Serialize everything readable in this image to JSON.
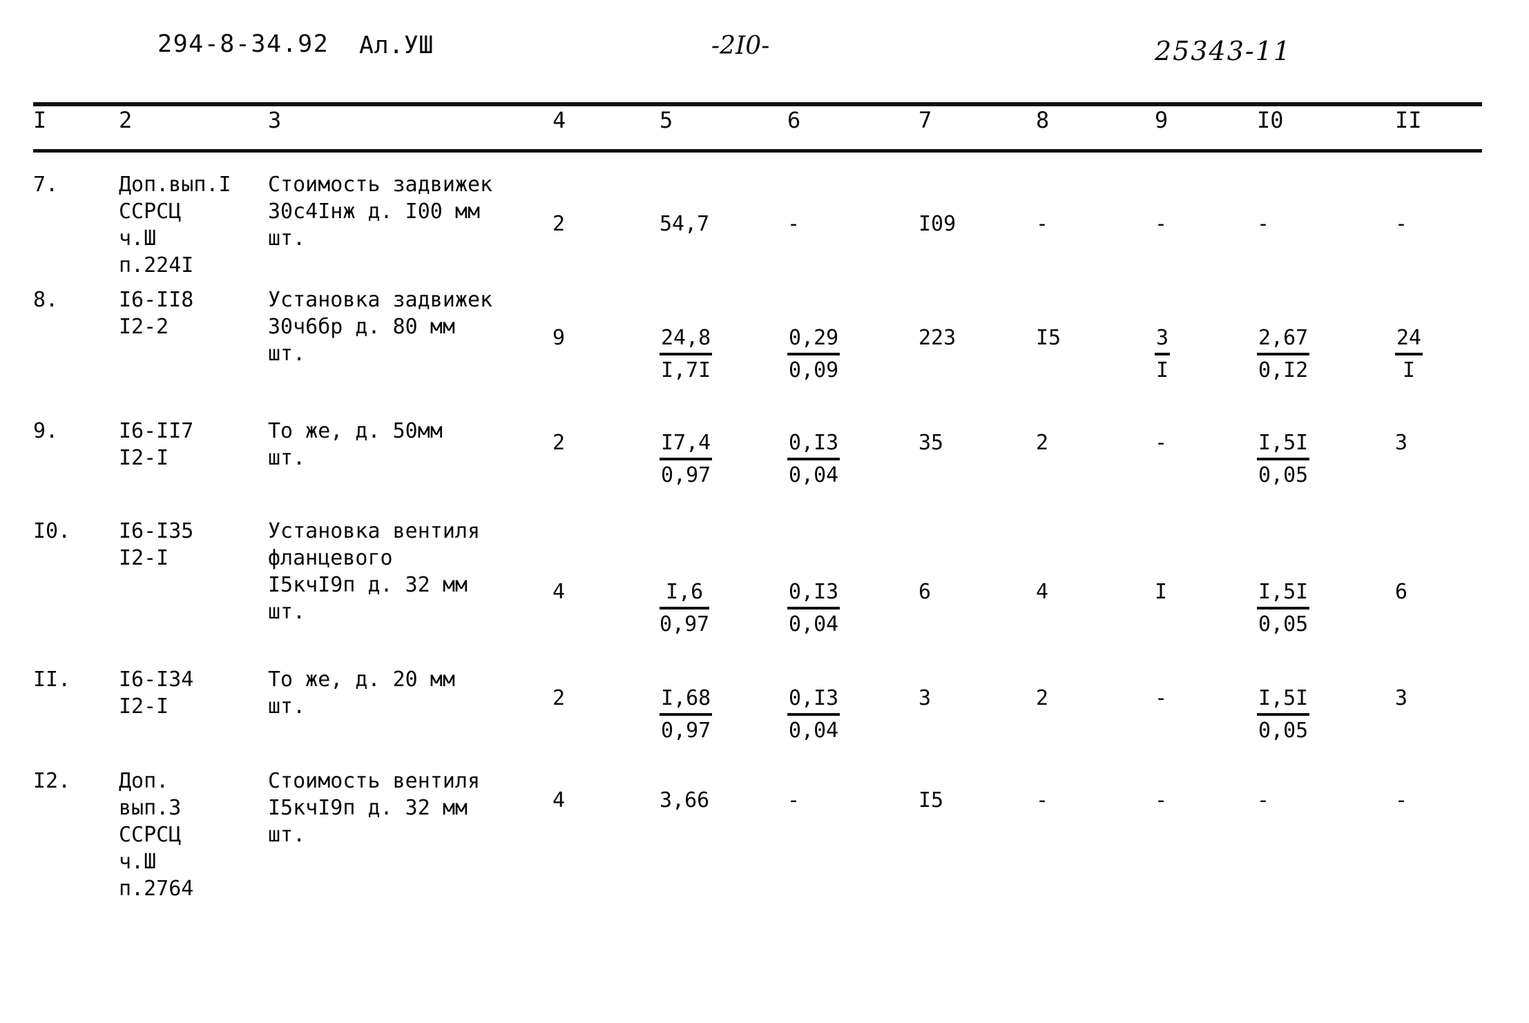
{
  "header": {
    "code": "294-8-34.92",
    "album": "Ал.УШ",
    "page_number": "-2I0-",
    "doc_number": "25343-11"
  },
  "table": {
    "column_numbers": [
      "I",
      "2",
      "3",
      "4",
      "5",
      "6",
      "7",
      "8",
      "9",
      "I0",
      "II"
    ],
    "rows": [
      {
        "no": "7.",
        "code": "Доп.вып.I\nССРСЦ\nч.Ш\nп.224I",
        "name": "Стоимость задвижек\n30с4Iнж д. I00 мм\nшт.",
        "c4": "2",
        "c5_num": "54,7",
        "c5_den": "",
        "c6_num": "-",
        "c6_den": "",
        "c7": "I09",
        "c8": "-",
        "c9_num": "-",
        "c9_den": "",
        "c10_num": "-",
        "c10_den": "",
        "c11_num": "-",
        "c11_den": ""
      },
      {
        "no": "8.",
        "code": "I6-II8\nI2-2",
        "name": "Установка задвижек\n30ч6бр д. 80 мм\nшт.",
        "c4": "9",
        "c5_num": "24,8",
        "c5_den": "I,7I",
        "c6_num": "0,29",
        "c6_den": "0,09",
        "c7": "223",
        "c8": "I5",
        "c9_num": "3",
        "c9_den": "I",
        "c10_num": "2,67",
        "c10_den": "0,I2",
        "c11_num": "24",
        "c11_den": "I"
      },
      {
        "no": "9.",
        "code": "I6-II7\nI2-I",
        "name": "То же, д. 50мм\nшт.",
        "c4": "2",
        "c5_num": "I7,4",
        "c5_den": "0,97",
        "c6_num": "0,I3",
        "c6_den": "0,04",
        "c7": "35",
        "c8": "2",
        "c9_num": "-",
        "c9_den": "",
        "c10_num": "I,5I",
        "c10_den": "0,05",
        "c11_num": "3",
        "c11_den": ""
      },
      {
        "no": "I0.",
        "code": "I6-I35\nI2-I",
        "name": "Установка вентиля\nфланцевого\nI5кчI9п д. 32 мм\nшт.",
        "c4": "4",
        "c5_num": "I,6",
        "c5_den": "0,97",
        "c6_num": "0,I3",
        "c6_den": "0,04",
        "c7": "6",
        "c8": "4",
        "c9_num": "I",
        "c9_den": "",
        "c10_num": "I,5I",
        "c10_den": "0,05",
        "c11_num": "6",
        "c11_den": ""
      },
      {
        "no": "II.",
        "code": "I6-I34\nI2-I",
        "name": "То же, д. 20 мм\nшт.",
        "c4": "2",
        "c5_num": "I,68",
        "c5_den": "0,97",
        "c6_num": "0,I3",
        "c6_den": "0,04",
        "c7": "3",
        "c8": "2",
        "c9_num": "-",
        "c9_den": "",
        "c10_num": "I,5I",
        "c10_den": "0,05",
        "c11_num": "3",
        "c11_den": ""
      },
      {
        "no": "I2.",
        "code": "Доп.\nвып.3\nССРСЦ\nч.Ш\nп.2764",
        "name": "Стоимость вентиля\nI5кчI9п д. 32 мм\nшт.",
        "c4": "4",
        "c5_num": "3,66",
        "c5_den": "",
        "c6_num": "-",
        "c6_den": "",
        "c7": "I5",
        "c8": "-",
        "c9_num": "-",
        "c9_den": "",
        "c10_num": "-",
        "c10_den": "",
        "c11_num": "-",
        "c11_den": ""
      }
    ]
  }
}
